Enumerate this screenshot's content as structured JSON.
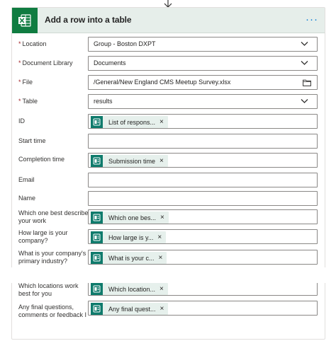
{
  "action": {
    "title": "Add a row into a table",
    "more_label": "···"
  },
  "icons": {
    "header": "excel-icon",
    "token": "forms-icon",
    "connector": "down-arrow-icon"
  },
  "colors": {
    "excel_green": "#107c41",
    "header_bg": "#e6eeea",
    "required": "#a4262c",
    "accent": "#0078d4",
    "token_bg": "#e6f0ec",
    "forms_teal": "#0f7b6c"
  },
  "fields": {
    "location": {
      "label": "Location",
      "required_mark": "*",
      "value": "Group - Boston DXPT"
    },
    "document_library": {
      "label": "Document Library",
      "required_mark": "*",
      "value": "Documents"
    },
    "file": {
      "label": "File",
      "required_mark": "*",
      "value": "/General/New England CMS Meetup Survey.xlsx"
    },
    "table": {
      "label": "Table",
      "required_mark": "*",
      "value": "results"
    },
    "id": {
      "label": "ID",
      "token": "List of respons...",
      "close": "×"
    },
    "start_time": {
      "label": "Start time",
      "value": ""
    },
    "completion_time": {
      "label": "Completion time",
      "token": "Submission time",
      "close": "×"
    },
    "email": {
      "label": "Email",
      "value": ""
    },
    "name": {
      "label": "Name",
      "value": ""
    },
    "describes_work": {
      "label": "Which one best describes your work",
      "token": "Which one bes...",
      "close": "×"
    },
    "company_size": {
      "label": "How large is your company?",
      "token": "How large is y...",
      "close": "×"
    },
    "industry": {
      "label": "What is your company's primary industry?",
      "token": "What is your c...",
      "close": "×"
    },
    "locations": {
      "label": "Which locations work best for you",
      "token": "Which location...",
      "close": "×"
    },
    "final_questions": {
      "label": "Any final questions, comments or feedback I",
      "token": "Any final quest...",
      "close": "×"
    }
  }
}
